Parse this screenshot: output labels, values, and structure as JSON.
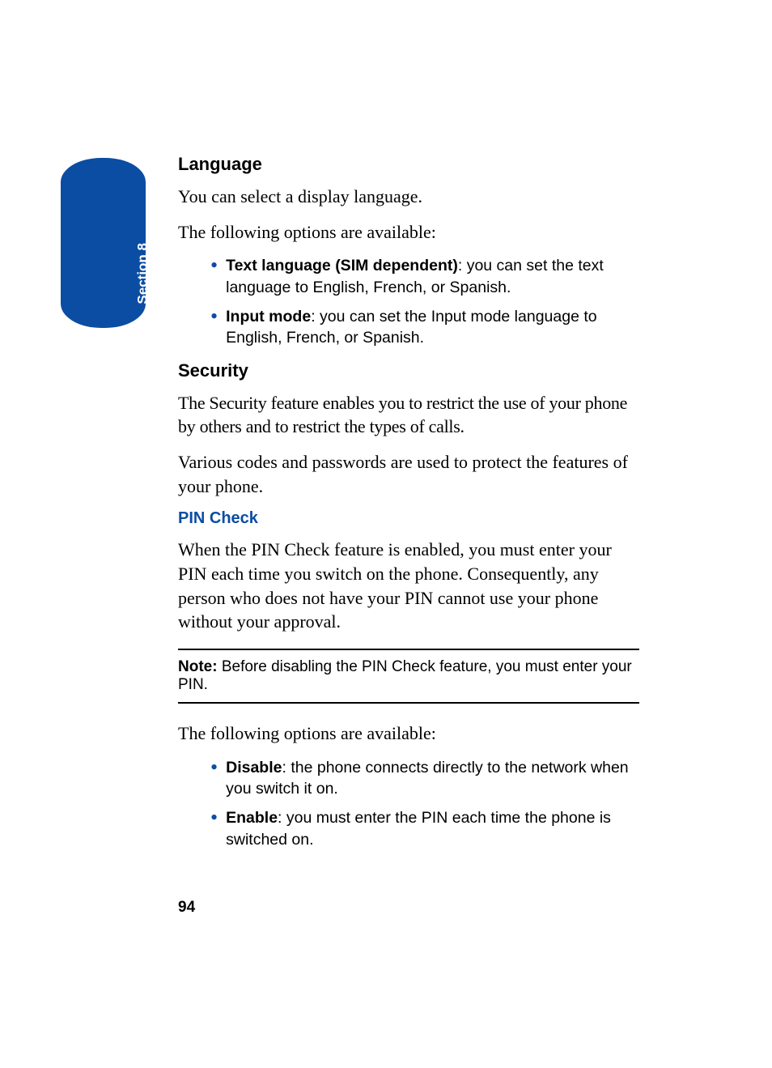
{
  "section_tab": "Section 8",
  "heading_language": "Language",
  "language_p1": "You can select a display language.",
  "language_p2": "The following options are available:",
  "bullet1_bold": "Text language (SIM dependent)",
  "bullet1_text": ": you can set the text language to English, French, or Spanish.",
  "bullet2_bold": "Input mode",
  "bullet2_text": ": you can set the Input mode language to English, French, or Spanish.",
  "heading_security": "Security",
  "security_p1": "The Security feature enables you to restrict the use of your phone by others and to restrict the types of calls.",
  "security_p2": "Various codes and passwords are used to protect the features of your phone.",
  "subheading_pin": "PIN Check",
  "pin_p1": "When the PIN Check feature is enabled, you must enter your PIN each time you switch on the phone. Consequently, any person who does not have your PIN cannot use your phone without your approval.",
  "note_bold": "Note: ",
  "note_text": "Before disabling the PIN Check feature, you must enter your PIN.",
  "pin_p2": "The following options are available:",
  "bullet3_bold": "Disable",
  "bullet3_text": ": the phone connects directly to the network when you switch it on.",
  "bullet4_bold": "Enable",
  "bullet4_text": ": you must enter the PIN each time the phone is switched on.",
  "page_number": "94"
}
